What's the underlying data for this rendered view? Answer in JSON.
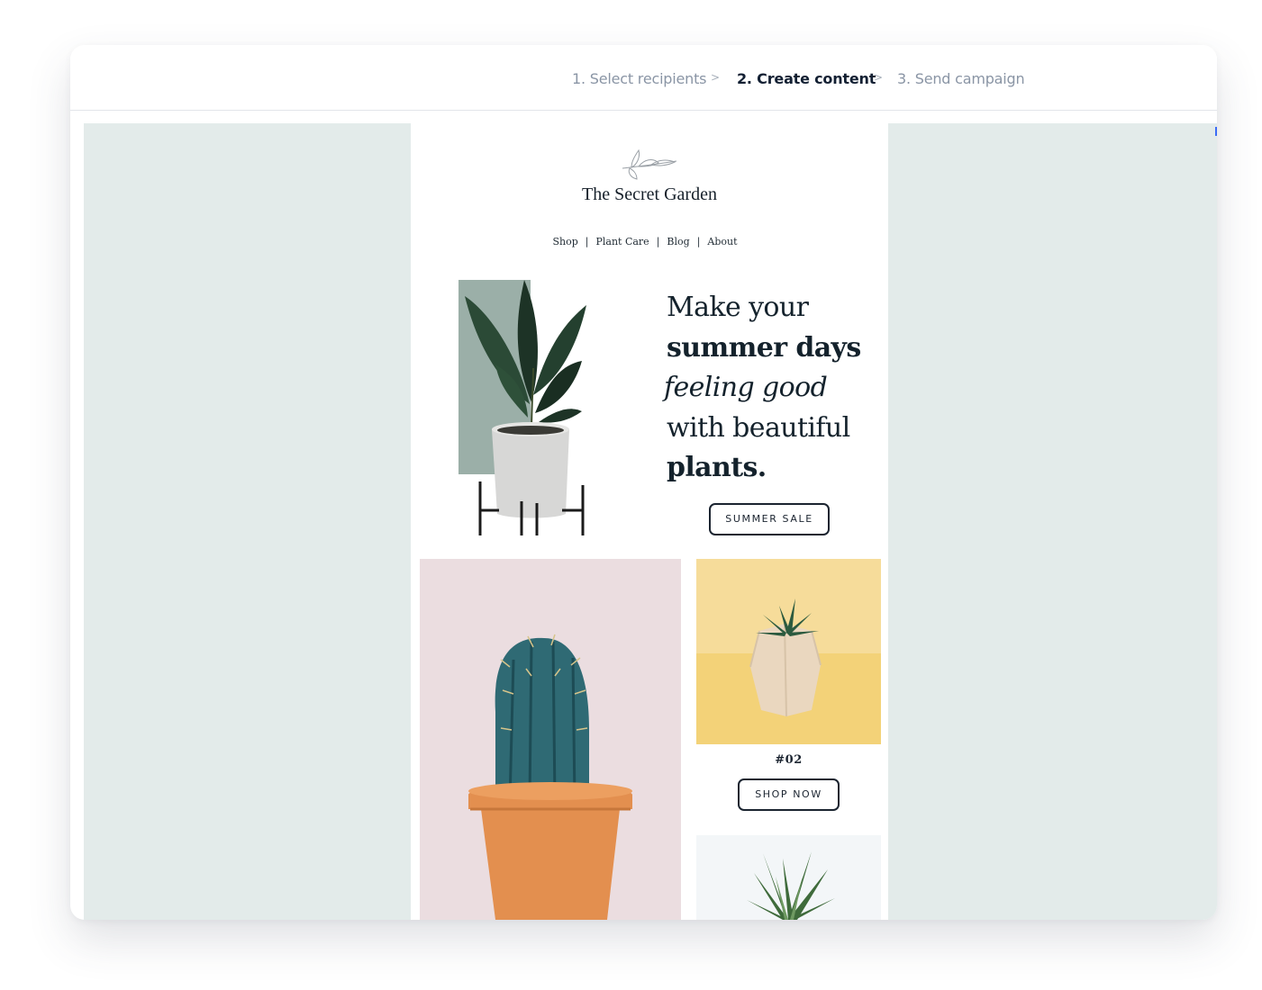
{
  "stepper": {
    "steps": [
      {
        "label": "1. Select recipients",
        "state": "done"
      },
      {
        "label": "2. Create content",
        "state": "active"
      },
      {
        "label": "3. Send campaign",
        "state": "upcoming"
      }
    ],
    "separator": ">"
  },
  "email": {
    "brand": {
      "name": "The Secret Garden",
      "logo_icon": "leaf-sprig-icon"
    },
    "nav": {
      "items": [
        "Shop",
        "Plant Care",
        "Blog",
        "About"
      ],
      "separator": "|"
    },
    "hero": {
      "headline": [
        {
          "text": "Make your",
          "style": "regular"
        },
        {
          "text": "summer days",
          "style": "bold"
        },
        {
          "text": "feeling good",
          "style": "italic"
        },
        {
          "text": "with beautiful",
          "style": "regular"
        },
        {
          "text": "plants.",
          "style": "bold"
        }
      ],
      "button_label": "SUMMER SALE",
      "image": "potted-rubber-plant"
    },
    "products": [
      {
        "image": "cactus-terracotta-pot"
      },
      {
        "number": "#02",
        "button_label": "SHOP NOW",
        "image": "succulent-wooden-pot"
      },
      {
        "image": "haworthia-succulent"
      }
    ]
  },
  "colors": {
    "canvas_background": "#e3ebea",
    "text_dark": "#14222c",
    "step_inactive": "#8a95a5",
    "step_active": "#132033",
    "accent_scroll": "#3c6cf5"
  }
}
